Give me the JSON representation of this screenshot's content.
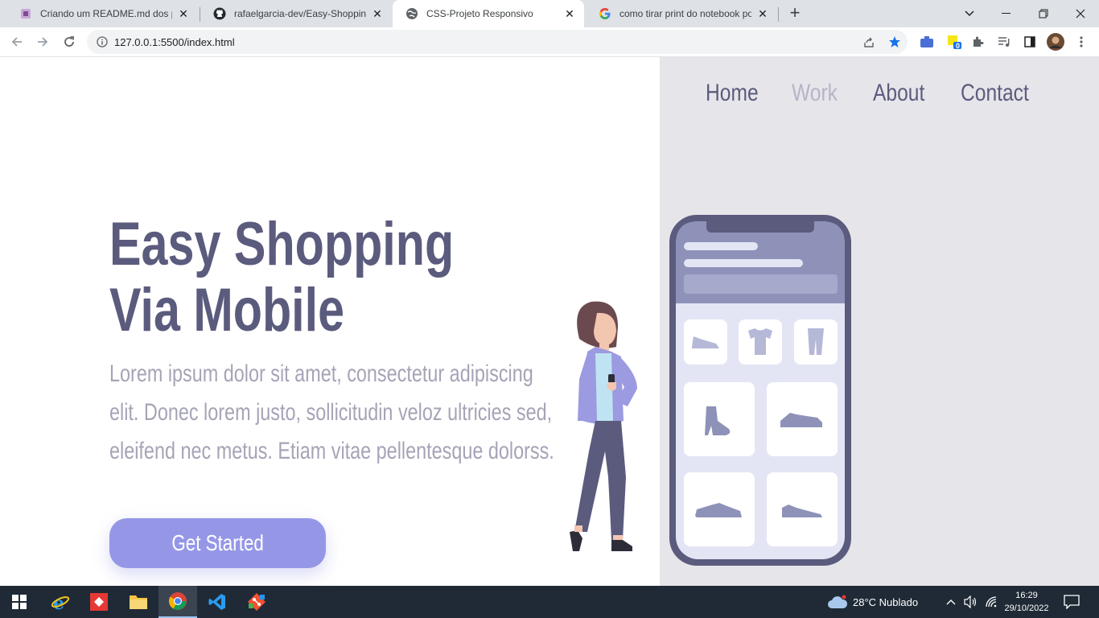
{
  "browser": {
    "tabs": [
      {
        "title": "Criando um README.md dos pro",
        "icon": "readme-favicon"
      },
      {
        "title": "rafaelgarcia-dev/Easy-Shopping",
        "icon": "github-icon"
      },
      {
        "title": "CSS-Projeto Responsivo",
        "icon": "globe-icon",
        "active": true
      },
      {
        "title": "como tirar print do notebook po",
        "icon": "google-icon"
      }
    ],
    "url": "127.0.0.1:5500/index.html",
    "extension_badge": "0"
  },
  "nav": {
    "items": [
      {
        "label": "Home"
      },
      {
        "label": "Work"
      },
      {
        "label": "About"
      },
      {
        "label": "Contact"
      }
    ]
  },
  "hero": {
    "title_line1": "Easy Shopping",
    "title_line2": "Via Mobile",
    "text": "Lorem ipsum dolor sit amet, consectetur adipiscing elit. Donec lorem justo, sollicitudin veloz ultricies sed, eleifend nec metus. Etiam vitae pellentesque dolorss.",
    "cta_label": "Get Started"
  },
  "colors": {
    "primary": "#5b5b7e",
    "muted": "#a5a4b7",
    "accent": "#9597e6",
    "panel": "#e6e5ea"
  },
  "taskbar": {
    "weather": "28°C  Nublado",
    "time": "16:29",
    "date": "29/10/2022"
  }
}
